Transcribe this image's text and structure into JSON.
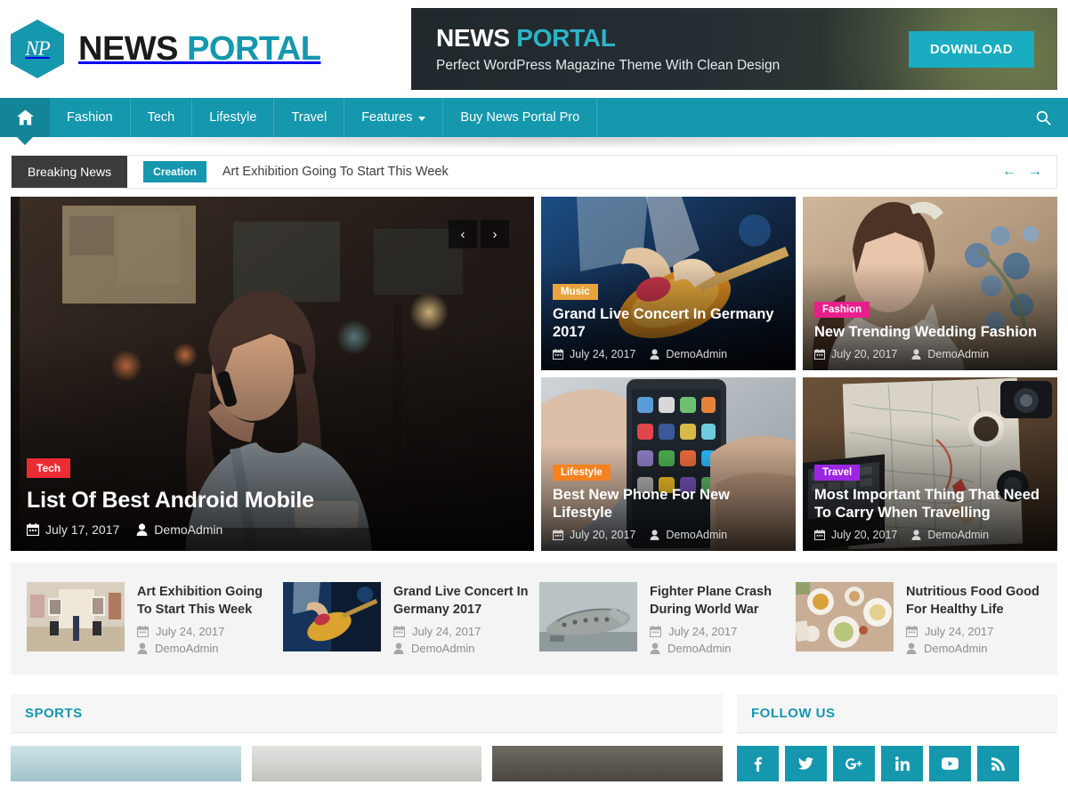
{
  "colors": {
    "brand_teal": "#1597ad",
    "nav_active": "#128599",
    "badge_tech": "#ec2b34",
    "badge_music": "#e8a33d",
    "badge_fashion": "#e91e8c",
    "badge_lifestyle": "#f58220",
    "badge_travel": "#9c27e0",
    "breaking_label_bg": "#3b3b3b"
  },
  "header": {
    "logo_mark": "NP",
    "logo_icon": "hexagon-logo-icon",
    "title_word1": "NEWS",
    "title_word2": "PORTAL",
    "ad": {
      "title_word1": "NEWS",
      "title_word2": "PORTAL",
      "subtitle": "Perfect  WordPress Magazine Theme With Clean Design",
      "button_label": "DOWNLOAD"
    }
  },
  "nav": {
    "home_icon": "home-icon",
    "search_icon": "search-icon",
    "items": [
      {
        "label": "Fashion",
        "has_dropdown": false
      },
      {
        "label": "Tech",
        "has_dropdown": false
      },
      {
        "label": "Lifestyle",
        "has_dropdown": false
      },
      {
        "label": "Travel",
        "has_dropdown": false
      },
      {
        "label": "Features",
        "has_dropdown": true
      },
      {
        "label": "Buy News Portal Pro",
        "has_dropdown": false
      }
    ]
  },
  "breaking": {
    "label": "Breaking News",
    "category": "Creation",
    "headline": "Art Exhibition Going To Start This Week",
    "prev_icon": "arrow-left-icon",
    "next_icon": "arrow-right-icon",
    "prev_glyph": "←",
    "next_glyph": "→"
  },
  "slider": {
    "prev_glyph": "‹",
    "next_glyph": "›"
  },
  "featured": {
    "main": {
      "category": "Tech",
      "category_color": "#ec2b34",
      "title": "List Of Best Android Mobile",
      "date": "July 17, 2017",
      "author": "DemoAdmin"
    },
    "small": [
      {
        "category": "Music",
        "category_color": "#e8a33d",
        "title": "Grand Live Concert In Germany 2017",
        "date": "July 24, 2017",
        "author": "DemoAdmin"
      },
      {
        "category": "Fashion",
        "category_color": "#e91e8c",
        "title": "New Trending Wedding Fashion",
        "date": "July 20, 2017",
        "author": "DemoAdmin"
      },
      {
        "category": "Lifestyle",
        "category_color": "#f58220",
        "title": "Best New Phone For New Lifestyle",
        "date": "July 20, 2017",
        "author": "DemoAdmin"
      },
      {
        "category": "Travel",
        "category_color": "#9c27e0",
        "title": "Most Important Thing That Need To Carry When Travelling",
        "date": "July 20, 2017",
        "author": "DemoAdmin"
      }
    ]
  },
  "strip": [
    {
      "title": "Art Exhibition Going To Start This Week",
      "date": "July 24, 2017",
      "author": "DemoAdmin"
    },
    {
      "title": "Grand Live Concert In Germany 2017",
      "date": "July 24, 2017",
      "author": "DemoAdmin"
    },
    {
      "title": "Fighter Plane Crash During World War",
      "date": "July 24, 2017",
      "author": "DemoAdmin"
    },
    {
      "title": "Nutritious Food Good For Healthy Life",
      "date": "July 24, 2017",
      "author": "DemoAdmin"
    }
  ],
  "sections": {
    "sports_title": "SPORTS",
    "follow_title": "FOLLOW US",
    "social": [
      "facebook-icon",
      "twitter-icon",
      "google-plus-icon",
      "linkedin-icon",
      "youtube-icon",
      "rss-icon"
    ]
  },
  "icons": {
    "calendar": "calendar-icon",
    "user": "user-icon"
  }
}
